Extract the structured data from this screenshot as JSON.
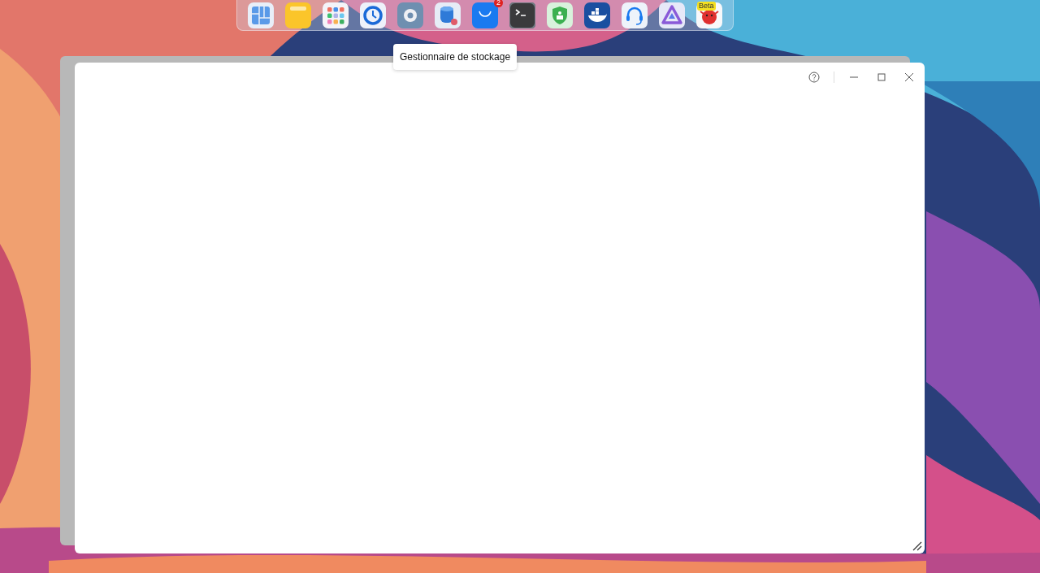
{
  "dock": {
    "items": [
      {
        "kind": "panels"
      },
      {
        "kind": "folder"
      },
      {
        "kind": "apps"
      },
      {
        "kind": "backup"
      },
      {
        "kind": "settings"
      },
      {
        "kind": "storage"
      },
      {
        "kind": "store",
        "badge": "2"
      },
      {
        "kind": "terminal"
      },
      {
        "kind": "shield"
      },
      {
        "kind": "whale"
      },
      {
        "kind": "headset"
      },
      {
        "kind": "triangle"
      },
      {
        "kind": "bird",
        "badge": "Beta"
      }
    ]
  },
  "tooltip": {
    "text": "Gestionnaire de stockage"
  },
  "window": {
    "controls": [
      {
        "kind": "help"
      },
      {
        "kind": "minimize"
      },
      {
        "kind": "maximize"
      },
      {
        "kind": "close"
      }
    ]
  }
}
